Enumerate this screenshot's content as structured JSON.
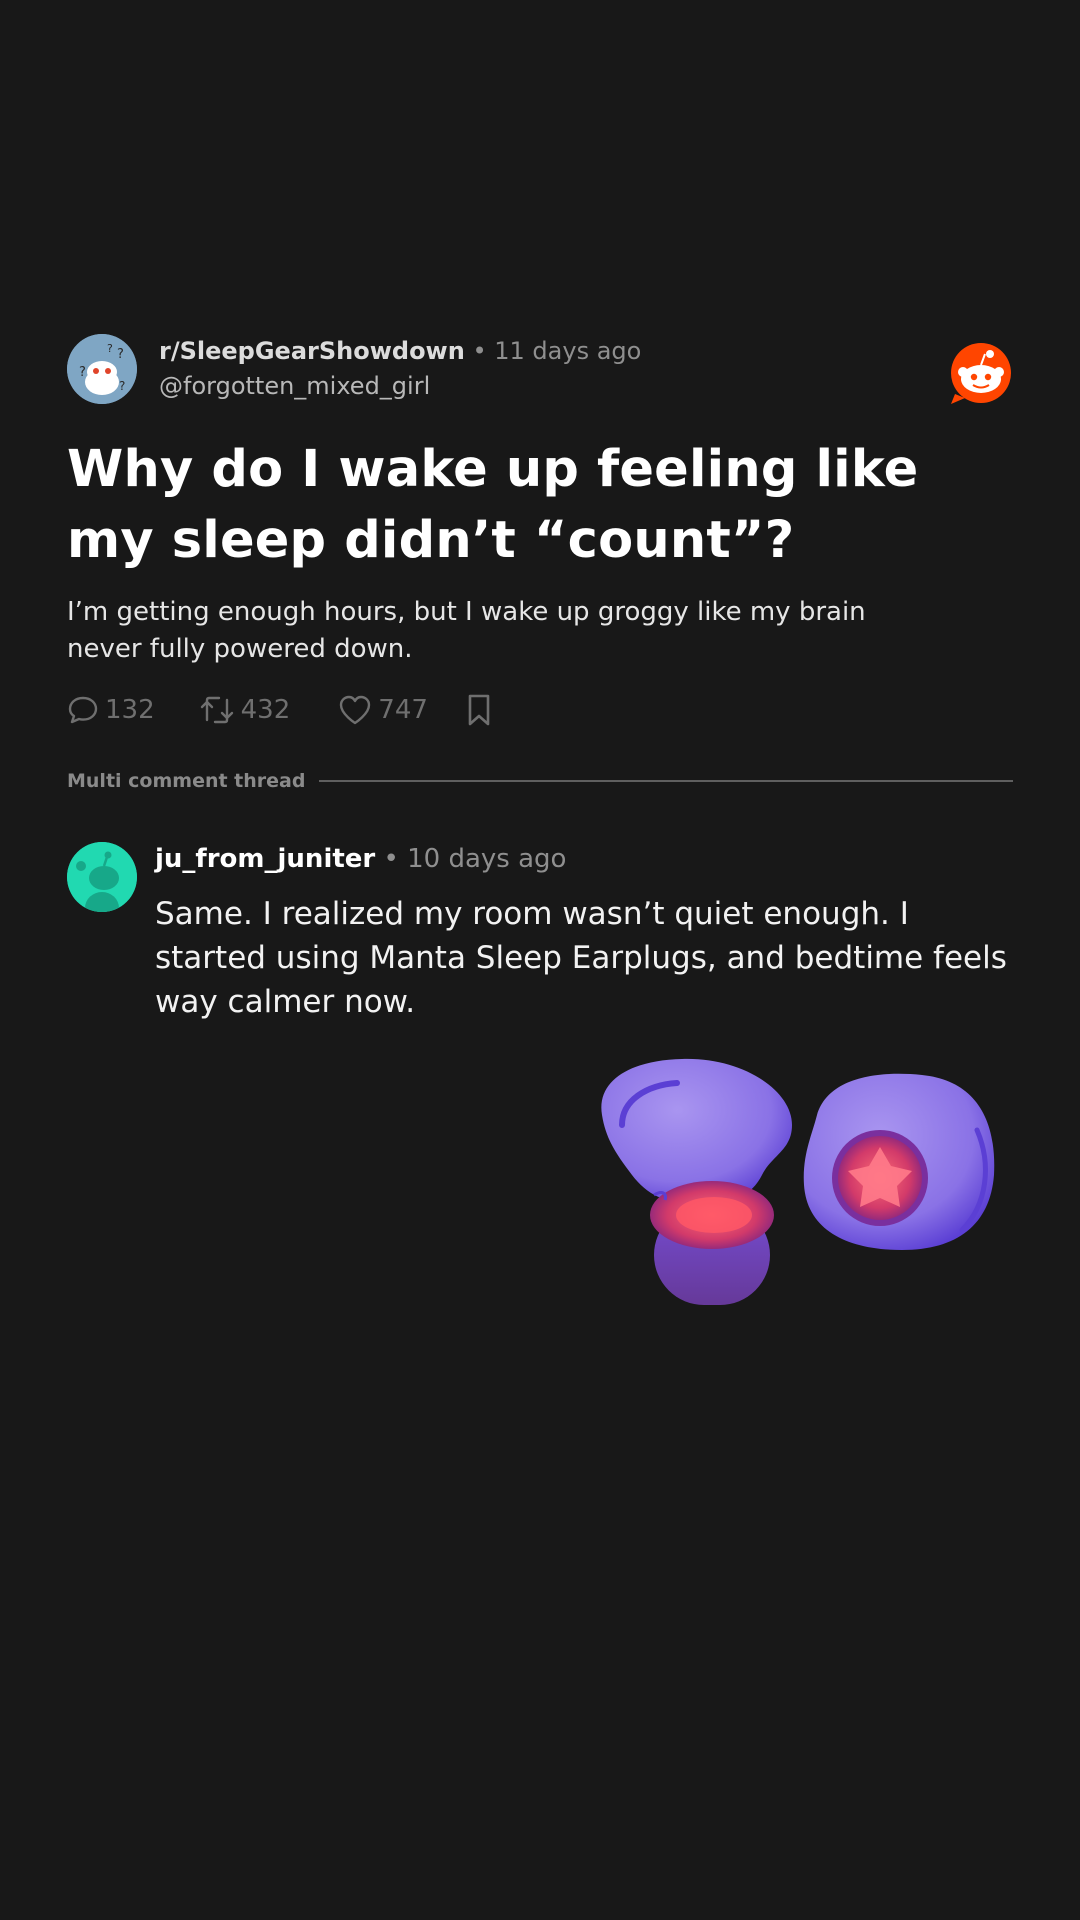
{
  "post": {
    "subreddit": "r/SleepGearShowdown",
    "time": "11 days ago",
    "username": "@forgotten_mixed_girl",
    "title": "Why do I wake up feeling like my sleep didn’t “count”?",
    "body": "I’m getting enough hours, but I wake up groggy like my brain never fully powered down.",
    "stats": {
      "comments": "132",
      "reposts": "432",
      "likes": "747"
    }
  },
  "thread": {
    "label": "Multi comment thread"
  },
  "comment": {
    "username": "ju_from_juniter",
    "time": "10 days ago",
    "text": "Same. I realized my room wasn’t quiet enough. I started using Manta Sleep Earplugs, and bedtime feels way calmer now."
  },
  "colors": {
    "background": "#181818",
    "reddit_orange": "#ff4500",
    "comment_avatar": "#21d9b1",
    "op_avatar": "#7fa6c4",
    "earplug_purple": "#8a72e6"
  },
  "icons": [
    "comment-icon",
    "repost-icon",
    "heart-icon",
    "bookmark-icon",
    "reddit-logo-icon"
  ]
}
